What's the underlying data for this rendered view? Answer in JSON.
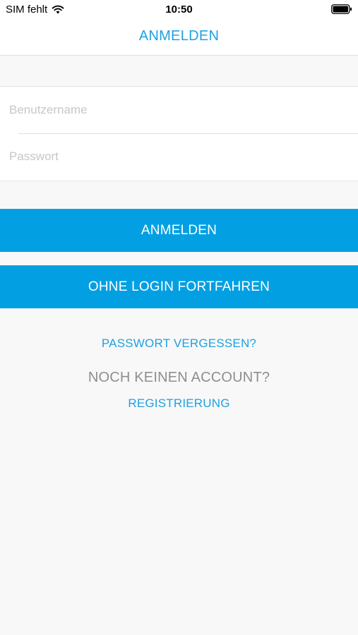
{
  "status_bar": {
    "carrier": "SIM fehlt",
    "time": "10:50",
    "wifi_icon": "wifi-icon",
    "battery_icon": "battery-icon"
  },
  "nav": {
    "title": "ANMELDEN"
  },
  "form": {
    "username_placeholder": "Benutzername",
    "username_value": "",
    "password_placeholder": "Passwort",
    "password_value": ""
  },
  "buttons": {
    "login": "ANMELDEN",
    "continue_without_login": "OHNE LOGIN FORTFAHREN"
  },
  "links": {
    "forgot_password": "PASSWORT VERGESSEN?",
    "no_account_text": "NOCH KEINEN ACCOUNT?",
    "register": "REGISTRIERUNG"
  },
  "colors": {
    "accent": "#02a0e3",
    "link": "#1ea1e0",
    "background": "#f8f8f8",
    "muted_text": "#8e8e8e"
  }
}
